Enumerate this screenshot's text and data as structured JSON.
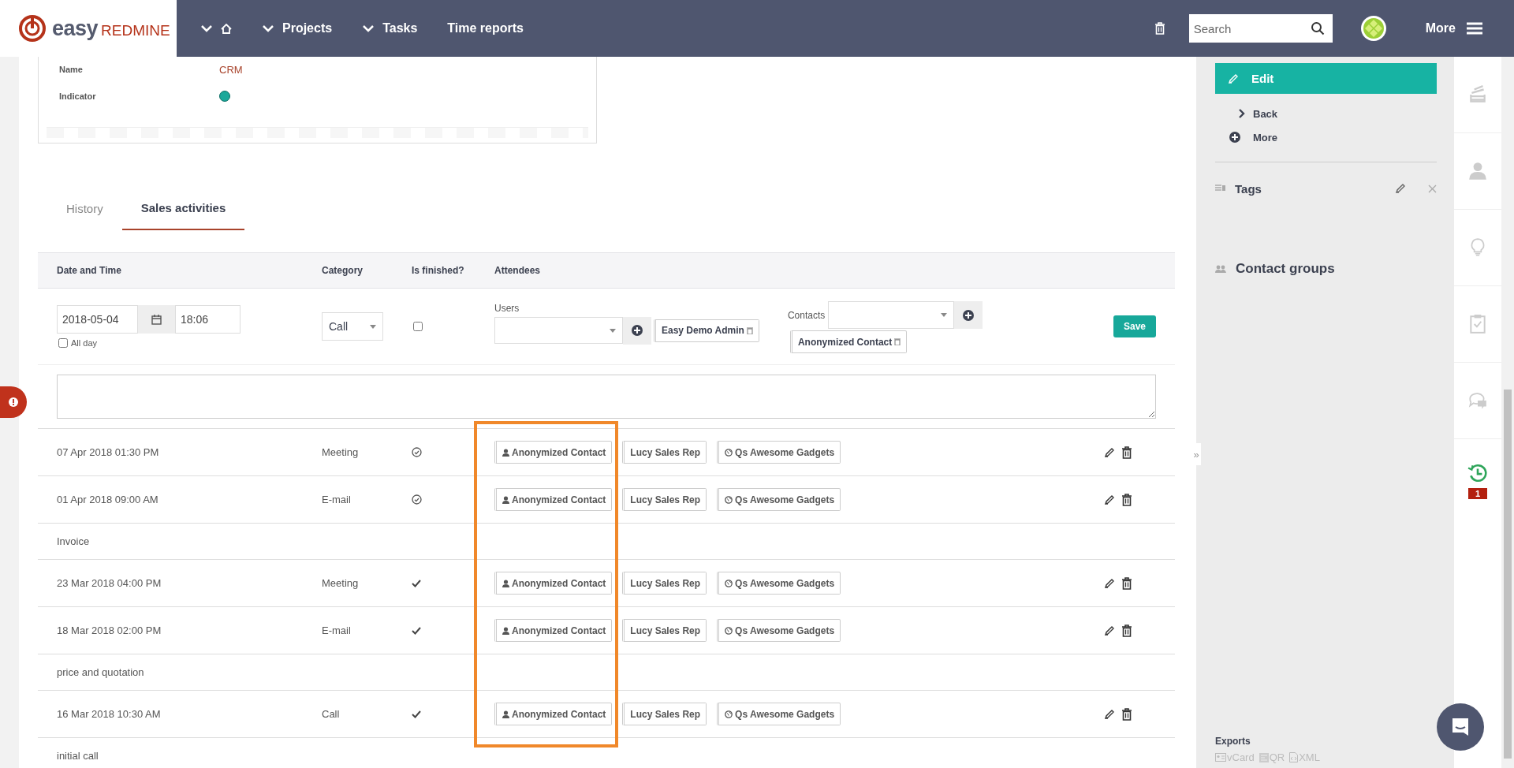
{
  "header": {
    "logo": {
      "word1": "easy",
      "word2": "REDMINE"
    },
    "nav": [
      {
        "kind": "home"
      },
      {
        "kind": "menu",
        "label": "Projects"
      },
      {
        "kind": "menu",
        "label": "Tasks"
      },
      {
        "kind": "link",
        "label": "Time reports"
      }
    ],
    "search": {
      "placeholder": "Search"
    },
    "more": "More"
  },
  "details": [
    {
      "label": "Name",
      "kind": "text",
      "value": "CRM"
    },
    {
      "label": "Indicator",
      "kind": "dot",
      "color": "#1aa89a"
    }
  ],
  "tabs": [
    {
      "label": "History",
      "selected": false
    },
    {
      "label": "Sales activities",
      "selected": true
    }
  ],
  "table": {
    "columns": [
      "Date and Time",
      "Category",
      "Is finished?",
      "Attendees"
    ],
    "form": {
      "date": "2018-05-04",
      "time": "18:06",
      "all_day": {
        "label": "All day",
        "checked": false
      },
      "category": "Call",
      "finished": false,
      "users_label": "Users",
      "users": [
        "Easy Demo Admin"
      ],
      "contacts_label": "Contacts",
      "contacts": [
        "Anonymized Contact"
      ],
      "save": "Save"
    },
    "rows": [
      {
        "date": "07 Apr 2018 01:30 PM",
        "category": "Meeting",
        "finished": true,
        "kind": "circled",
        "attendees": [
          {
            "kind": "contact",
            "name": "Anonymized Contact"
          },
          {
            "kind": "user",
            "name": "Lucy Sales Rep"
          },
          {
            "kind": "company",
            "name": "Qs Awesome Gadgets"
          }
        ]
      },
      {
        "date": "01 Apr 2018 09:00 AM",
        "category": "E-mail",
        "finished": true,
        "kind": "circled",
        "attendees": [
          {
            "kind": "contact",
            "name": "Anonymized Contact"
          },
          {
            "kind": "user",
            "name": "Lucy Sales Rep"
          },
          {
            "kind": "company",
            "name": "Qs Awesome Gadgets"
          }
        ],
        "note": "Invoice"
      },
      {
        "date": "23 Mar 2018 04:00 PM",
        "category": "Meeting",
        "finished": true,
        "kind": "plain",
        "attendees": [
          {
            "kind": "contact",
            "name": "Anonymized Contact"
          },
          {
            "kind": "user",
            "name": "Lucy Sales Rep"
          },
          {
            "kind": "company",
            "name": "Qs Awesome Gadgets"
          }
        ]
      },
      {
        "date": "18 Mar 2018 02:00 PM",
        "category": "E-mail",
        "finished": true,
        "kind": "plain",
        "attendees": [
          {
            "kind": "contact",
            "name": "Anonymized Contact"
          },
          {
            "kind": "user",
            "name": "Lucy Sales Rep"
          },
          {
            "kind": "company",
            "name": "Qs Awesome Gadgets"
          }
        ],
        "note": "price and quotation"
      },
      {
        "date": "16 Mar 2018 10:30 AM",
        "category": "Call",
        "finished": true,
        "kind": "plain",
        "attendees": [
          {
            "kind": "contact",
            "name": "Anonymized Contact"
          },
          {
            "kind": "user",
            "name": "Lucy Sales Rep"
          },
          {
            "kind": "company",
            "name": "Qs Awesome Gadgets"
          }
        ],
        "note": "initial call"
      }
    ]
  },
  "sidebar": {
    "edit": "Edit",
    "links": [
      {
        "kind": "back",
        "label": "Back"
      },
      {
        "kind": "more",
        "label": "More"
      }
    ],
    "tags": "Tags",
    "contact_groups": "Contact groups",
    "toggle": "»",
    "exports": {
      "title": "Exports",
      "items": [
        {
          "kind": "vcard",
          "label": "vCard"
        },
        {
          "kind": "qr",
          "label": "QR"
        },
        {
          "kind": "xml",
          "label": "XML"
        }
      ]
    }
  },
  "rail": [
    {
      "kind": "stack"
    },
    {
      "kind": "person"
    },
    {
      "kind": "bulb"
    },
    {
      "kind": "clipboard"
    },
    {
      "kind": "chat"
    },
    {
      "kind": "history",
      "badge": "1"
    }
  ]
}
